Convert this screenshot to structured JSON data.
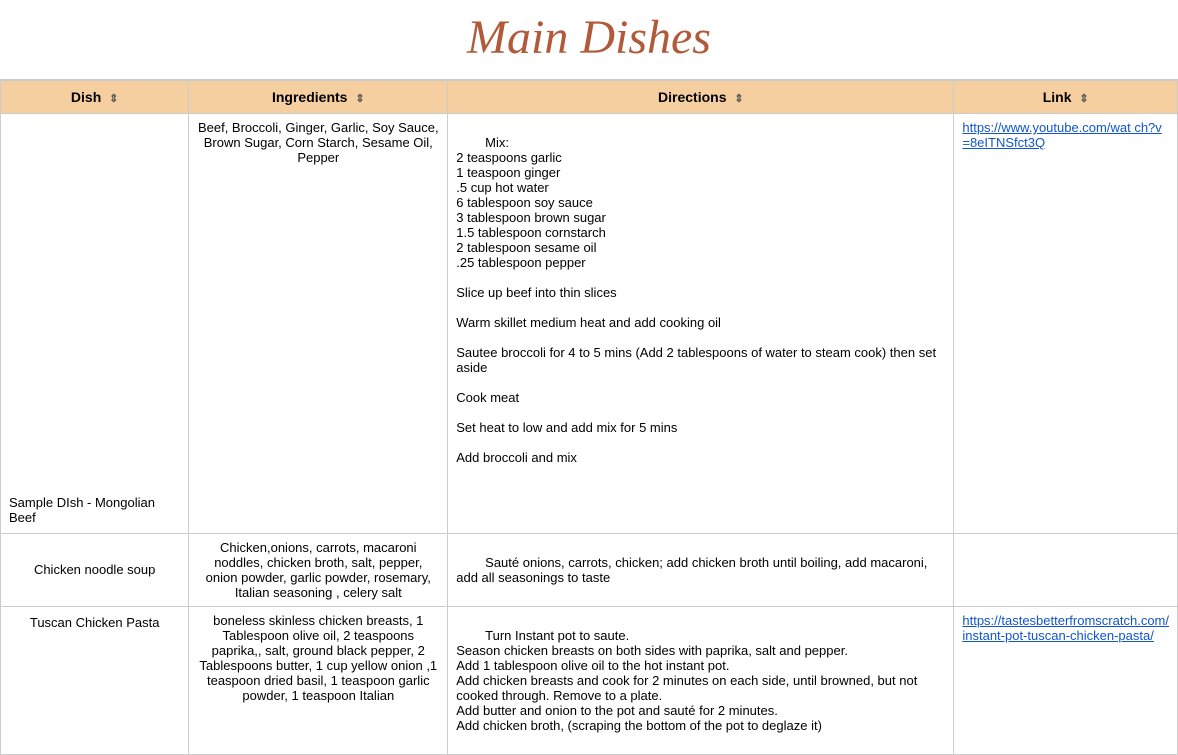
{
  "page": {
    "title": "Main Dishes"
  },
  "table": {
    "headers": [
      {
        "label": "Dish",
        "filter": "⊟"
      },
      {
        "label": "Ingredients",
        "filter": "⊟"
      },
      {
        "label": "Directions",
        "filter": "⊟"
      },
      {
        "label": "Link",
        "filter": "⊟"
      }
    ],
    "rows": [
      {
        "dish": "Sample DIsh - Mongolian Beef",
        "ingredients": "Beef, Broccoli, Ginger, Garlic, Soy Sauce, Brown Sugar, Corn Starch, Sesame Oil, Pepper",
        "directions": "Mix:\n2 teaspoons garlic\n1 teaspoon ginger\n.5 cup hot water\n6 tablespoon soy sauce\n3 tablespoon brown sugar\n1.5 tablespoon cornstarch\n2 tablespoon sesame oil\n.25 tablespoon pepper\n\nSlice up beef into thin slices\n\nWarm skillet medium heat and add cooking oil\n\nSautee broccoli for 4 to 5 mins (Add 2 tablespoons of water to steam cook) then set aside\n\nCook meat\n\nSet heat to low and add mix for 5 mins\n\nAdd broccoli and mix",
        "link": "https://www.youtube.com/watch?v=8eITNSfct3Q",
        "link_display": "https://www.youtube.com/wat\nch?v=8eITNSfct3Q"
      },
      {
        "dish": "Chicken noodle soup",
        "ingredients": "Chicken,onions, carrots, macaroni noddles, chicken broth, salt, pepper, onion powder, garlic powder, rosemary, Italian seasoning , celery salt",
        "directions": "Sauté onions, carrots, chicken; add chicken broth until boiling, add macaroni, add all seasonings to taste",
        "link": "",
        "link_display": ""
      },
      {
        "dish": "Tuscan Chicken Pasta",
        "ingredients": "boneless skinless chicken breasts, 1 Tablespoon olive oil,  2 teaspoons paprika,, salt, ground black pepper, 2 Tablespoons butter, 1 cup yellow onion ,1 teaspoon dried basil, 1 teaspoon garlic powder, 1 teaspoon Italian",
        "directions": "Turn Instant pot to saute.\nSeason chicken breasts on both sides with paprika, salt and pepper.\nAdd 1 tablespoon olive oil to the hot instant pot.\nAdd chicken breasts and cook for 2 minutes on each side, until browned, but not cooked through. Remove to a plate.\nAdd butter and onion to the pot and sauté for 2 minutes.\nAdd chicken broth, (scraping the bottom of the pot to deglaze it)",
        "link": "https://tastesbetterfromscratch.com/instant-pot-tuscan-chicken-pasta/",
        "link_display": "https://tastesbetterfromscratch.com/instant-pot-tuscan-chicken-pasta/"
      }
    ]
  }
}
